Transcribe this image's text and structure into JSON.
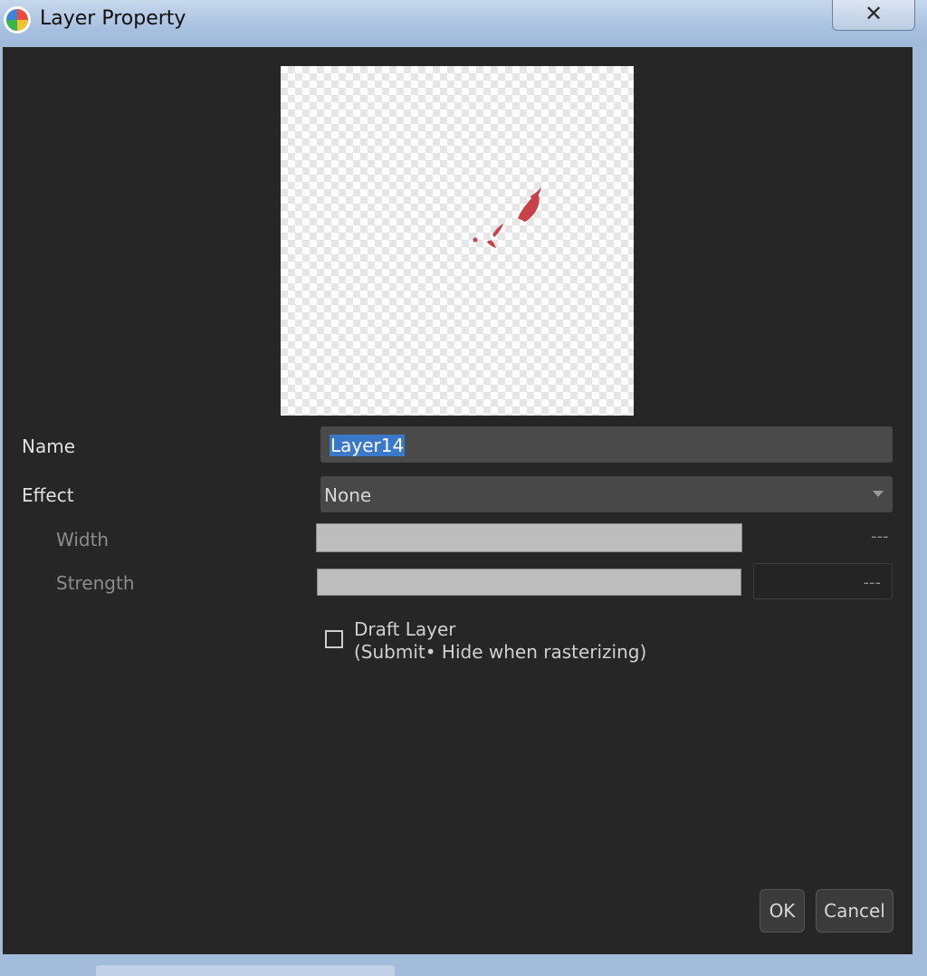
{
  "window": {
    "title": "Layer Property",
    "close_symbol": "✕"
  },
  "form": {
    "name_label": "Name",
    "name_value": "Layer14",
    "effect_label": "Effect",
    "effect_value": "None",
    "width_label": "Width",
    "width_value": "---",
    "strength_label": "Strength",
    "strength_value": "---"
  },
  "draft": {
    "checked": false,
    "label": "Draft Layer",
    "hint": "(Submit• Hide when rasterizing)"
  },
  "buttons": {
    "ok": "OK",
    "cancel": "Cancel"
  },
  "icons": {
    "app": "app-color-wheel-icon",
    "close": "close-icon",
    "dropdown": "chevron-down-icon"
  },
  "colors": {
    "background": "#262626",
    "selection": "#3a78c9",
    "stroke_red": "#c8424a"
  }
}
